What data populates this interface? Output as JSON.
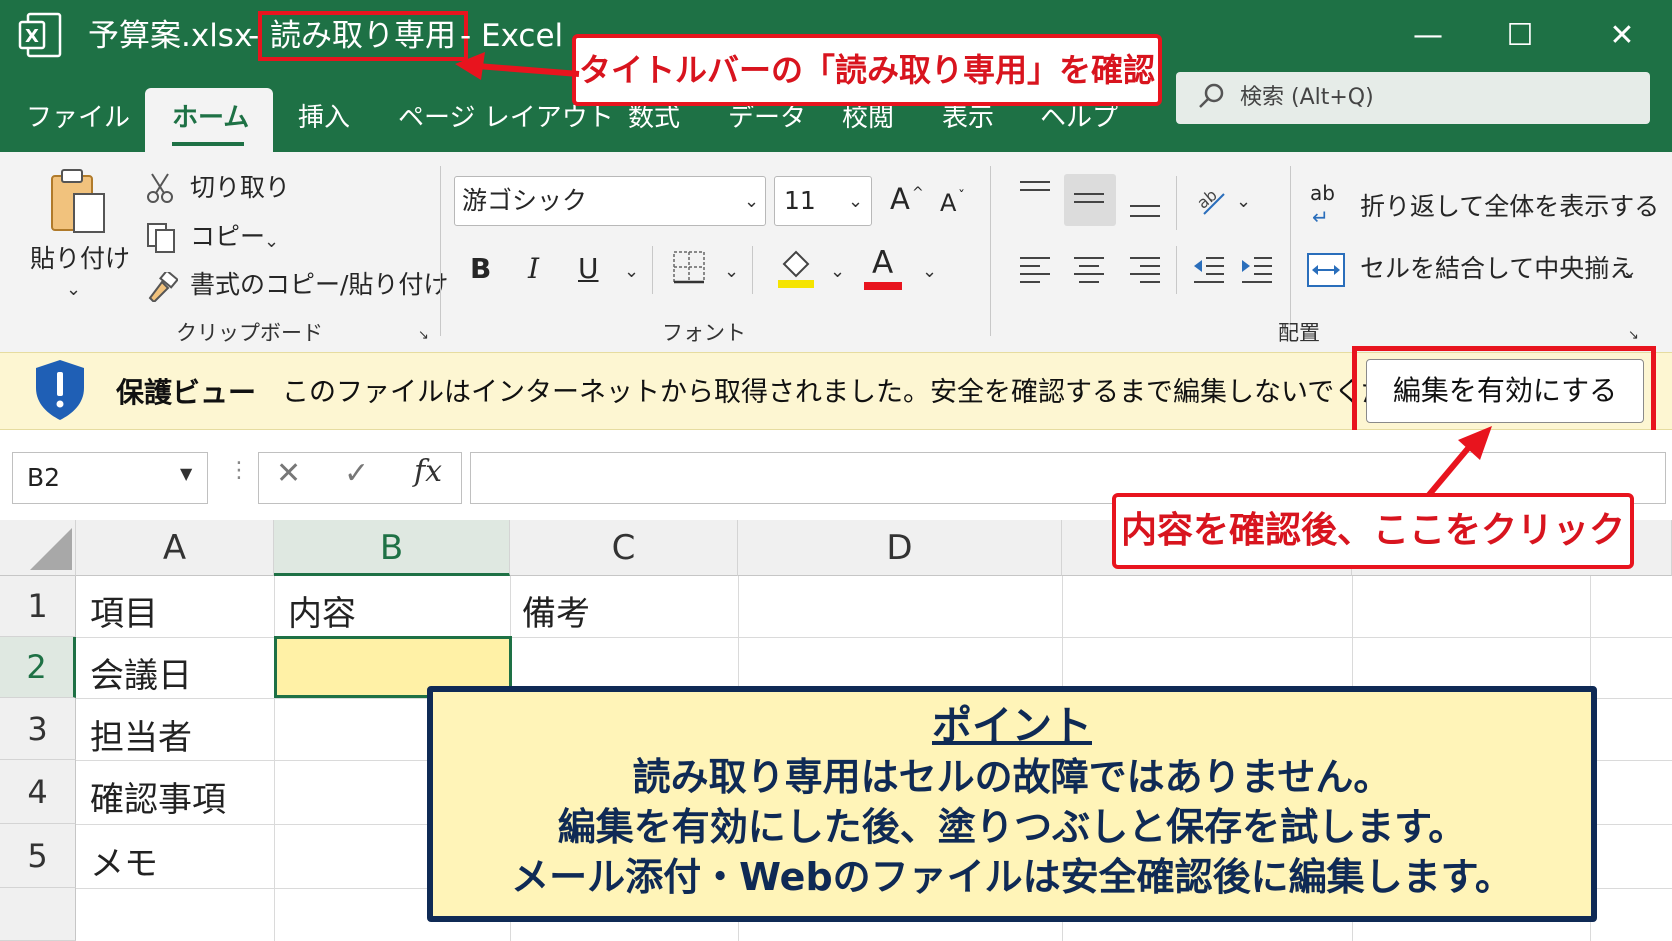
{
  "window": {
    "filename": "予算案.xlsx",
    "dash1": "-",
    "readonly_tag": "読み取り専用",
    "app": "- Excel",
    "minimize": "—",
    "maximize": "☐",
    "close": "✕"
  },
  "callouts": {
    "titlebar_note": "タイトルバーの「読み取り専用」を確認",
    "click_note": "内容を確認後、ここをクリック"
  },
  "menu": {
    "items": [
      "ファイル",
      "ホーム",
      "挿入",
      "ページ レイアウト",
      "数式",
      "データ",
      "校閲",
      "表示",
      "ヘルプ"
    ],
    "active": "ホーム"
  },
  "search": {
    "placeholder": "検索 (Alt+Q)"
  },
  "ribbon": {
    "clipboard": {
      "paste": "貼り付け",
      "cut": "切り取り",
      "copy": "コピー",
      "format_painter": "書式のコピー/貼り付け",
      "group": "クリップボード"
    },
    "font": {
      "family": "游ゴシック",
      "size": "11",
      "bold": "B",
      "italic": "I",
      "underline": "U",
      "font_color_glyph": "A",
      "grow": "A",
      "shrink": "A",
      "group": "フォント",
      "highlight_color": "#f5e400",
      "font_color": "#e8141e"
    },
    "alignment": {
      "wrap_text": "折り返して全体を表示する",
      "merge_center": "セルを結合して中央揃え",
      "wrap_glyph": "ab",
      "group": "配置"
    }
  },
  "protected_view": {
    "title": "保護ビュー",
    "message": "このファイルはインターネットから取得されました。安全を確認するまで編集しないでください。",
    "button": "編集を有効にする"
  },
  "formula_bar": {
    "name_box": "B2",
    "cancel": "✕",
    "enter": "✓",
    "fx": "fx",
    "value": ""
  },
  "sheet": {
    "columns": [
      "A",
      "B",
      "C",
      "D"
    ],
    "rows": [
      "1",
      "2",
      "3",
      "4",
      "5"
    ],
    "cells": {
      "A1": "項目",
      "B1": "内容",
      "C1": "備考",
      "A2": "会議日",
      "A3": "担当者",
      "A4": "確認事項",
      "A5": "メモ"
    },
    "selected_cell": "B2"
  },
  "point_box": {
    "title": "ポイント",
    "lines": [
      "読み取り専用はセルの故障ではありません。",
      "編集を有効にした後、塗りつぶしと保存を試します。",
      "メール添付・Webのファイルは安全確認後に編集します。"
    ]
  },
  "colors": {
    "excel_green": "#1e7145",
    "callout_red": "#e8141e",
    "protect_bg": "#fdf6d2",
    "point_bg": "#fff4b8",
    "point_border": "#0f2a55"
  }
}
